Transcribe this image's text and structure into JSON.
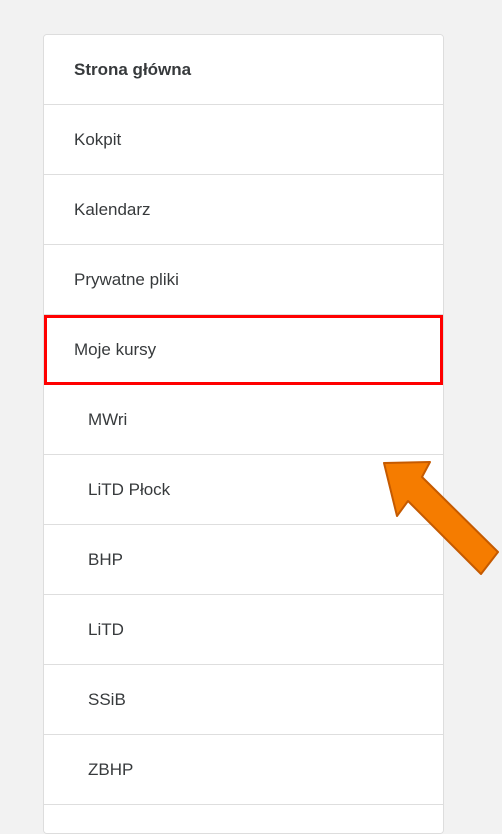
{
  "nav": {
    "items": [
      {
        "key": "home",
        "label": "Strona główna",
        "kind": "home"
      },
      {
        "key": "kokpit",
        "label": "Kokpit",
        "kind": "top"
      },
      {
        "key": "kalendarz",
        "label": "Kalendarz",
        "kind": "top"
      },
      {
        "key": "prywatne-pliki",
        "label": "Prywatne pliki",
        "kind": "top"
      },
      {
        "key": "moje-kursy",
        "label": "Moje kursy",
        "kind": "top",
        "highlighted": true
      },
      {
        "key": "mwri",
        "label": "MWri",
        "kind": "sub"
      },
      {
        "key": "litd-plock",
        "label": "LiTD Płock",
        "kind": "sub"
      },
      {
        "key": "bhp",
        "label": "BHP",
        "kind": "sub"
      },
      {
        "key": "litd",
        "label": "LiTD",
        "kind": "sub"
      },
      {
        "key": "ssib",
        "label": "SSiB",
        "kind": "sub"
      },
      {
        "key": "zbhp",
        "label": "ZBHP",
        "kind": "sub"
      }
    ]
  },
  "annotations": {
    "highlight_color": "#ff0000",
    "arrow_icon": "orange-arrow-icon",
    "arrow_color": "#f57c00",
    "arrow_outline_color": "#c55a00"
  }
}
